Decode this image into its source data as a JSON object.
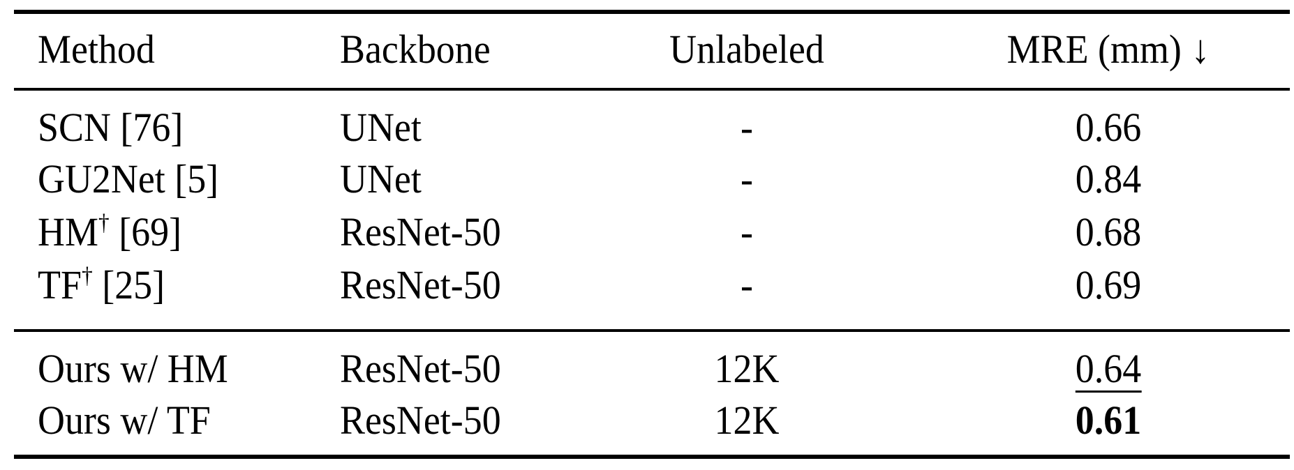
{
  "table": {
    "headers": {
      "method": "Method",
      "backbone": "Backbone",
      "unlabeled": "Unlabeled",
      "mre": "MRE (mm) ↓"
    },
    "rows": [
      {
        "method": "SCN",
        "dagger": "",
        "ref": "[76]",
        "backbone": "UNet",
        "unlabeled": "-",
        "mre": "0.66",
        "style": "normal"
      },
      {
        "method": "GU2Net",
        "dagger": "",
        "ref": "[5]",
        "backbone": "UNet",
        "unlabeled": "-",
        "mre": "0.84",
        "style": "normal"
      },
      {
        "method": "HM",
        "dagger": "†",
        "ref": "[69]",
        "backbone": "ResNet-50",
        "unlabeled": "-",
        "mre": "0.68",
        "style": "normal"
      },
      {
        "method": "TF",
        "dagger": "†",
        "ref": "[25]",
        "backbone": "ResNet-50",
        "unlabeled": "-",
        "mre": "0.69",
        "style": "normal"
      },
      {
        "method": "Ours w/ HM",
        "dagger": "",
        "ref": "",
        "backbone": "ResNet-50",
        "unlabeled": "12K",
        "mre": "0.64",
        "style": "underline"
      },
      {
        "method": "Ours w/ TF",
        "dagger": "",
        "ref": "",
        "backbone": "ResNet-50",
        "unlabeled": "12K",
        "mre": "0.61",
        "style": "bold"
      }
    ]
  }
}
